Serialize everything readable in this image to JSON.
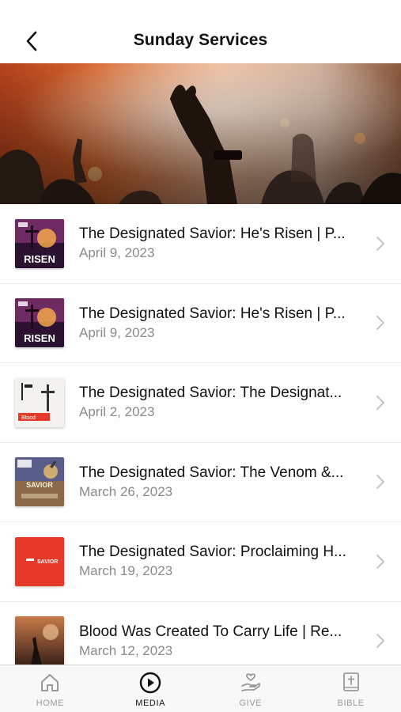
{
  "header": {
    "title": "Sunday Services"
  },
  "hero": {
    "icon": "worship-hero-image"
  },
  "sermons": [
    {
      "title": "The Designated Savior: He's Risen | P...",
      "date": "April 9, 2023",
      "thumb_text": "RISEN"
    },
    {
      "title": "The Designated Savior: He's Risen | P...",
      "date": "April 9, 2023",
      "thumb_text": "RISEN"
    },
    {
      "title": "The Designated Savior: The Designat...",
      "date": "April 2, 2023",
      "thumb_text": "Blood"
    },
    {
      "title": "The Designated Savior: The Venom &...",
      "date": "March 26, 2023",
      "thumb_text": "SAVIOR"
    },
    {
      "title": "The Designated Savior: Proclaiming H...",
      "date": "March 19, 2023",
      "thumb_text": "SAVIOR"
    },
    {
      "title": "Blood Was Created To Carry Life | Re...",
      "date": "March 12, 2023",
      "thumb_text": ""
    }
  ],
  "tabbar": {
    "items": [
      {
        "label": "HOME",
        "icon": "home-icon",
        "active": false
      },
      {
        "label": "MEDIA",
        "icon": "play-circle-icon",
        "active": true
      },
      {
        "label": "GIVE",
        "icon": "give-hand-icon",
        "active": false
      },
      {
        "label": "BIBLE",
        "icon": "bible-icon",
        "active": false
      }
    ]
  },
  "colors": {
    "accent_red": "#e53a2a",
    "text_primary": "#111111",
    "text_secondary": "#8a8a8a",
    "tab_inactive": "#9a9a9a"
  }
}
